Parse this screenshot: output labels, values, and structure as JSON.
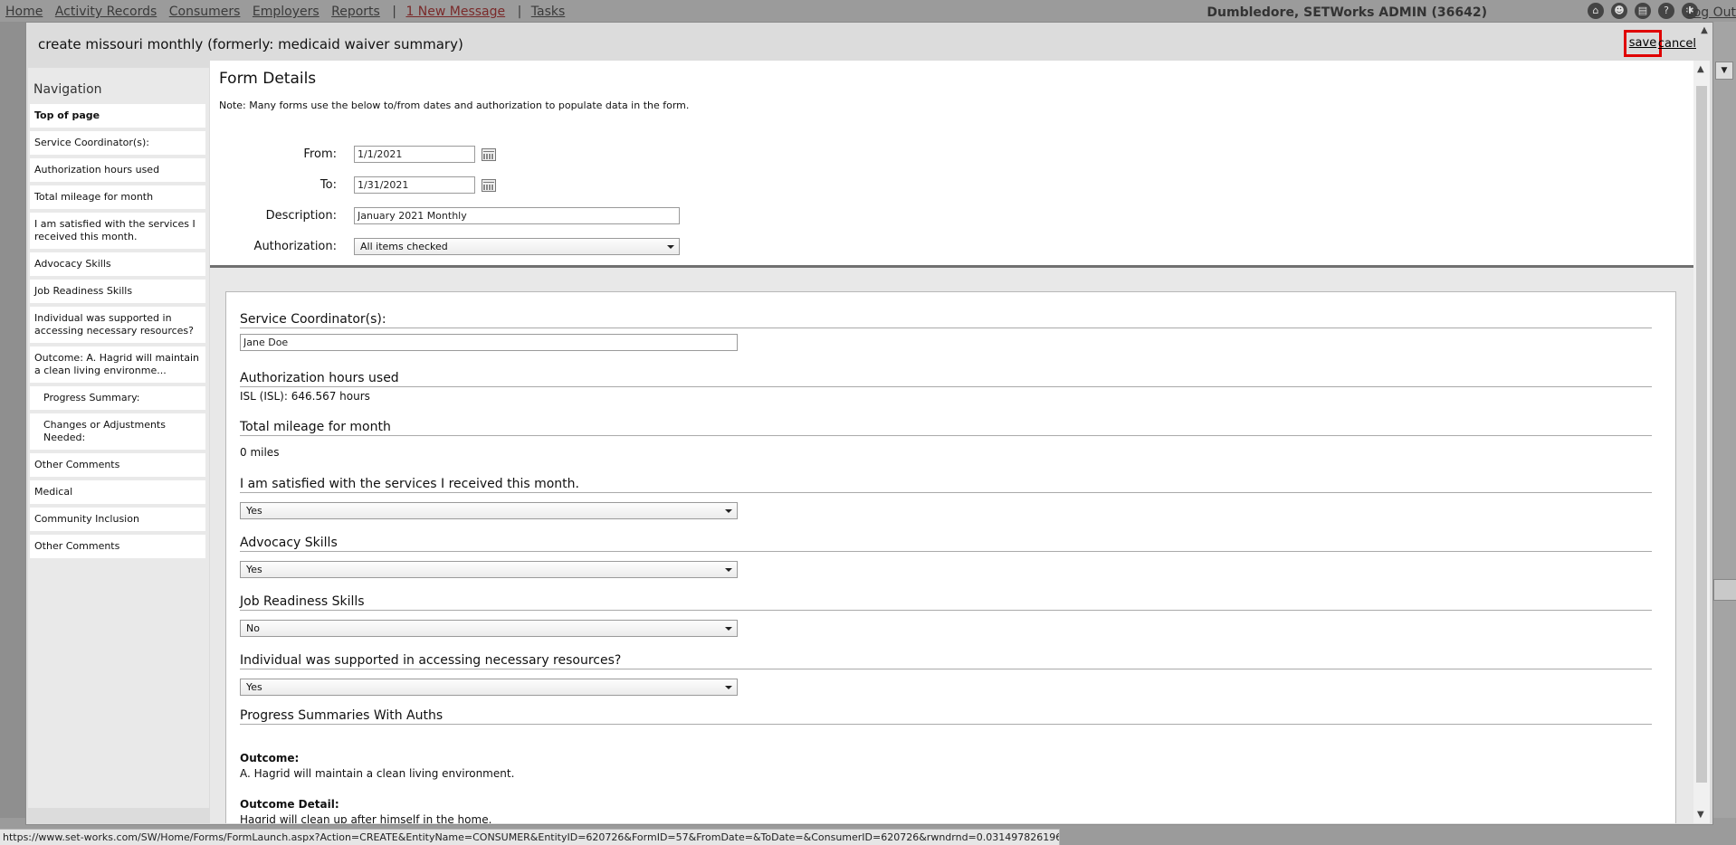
{
  "background": {
    "nav": [
      "Home",
      "Activity Records",
      "Consumers",
      "Employers",
      "Reports"
    ],
    "message": "1 New Message",
    "tasks": "Tasks",
    "user": "Dumbledore, SETWorks ADMIN (36642)",
    "logout": "Log Out"
  },
  "modal": {
    "title": "create missouri monthly (formerly: medicaid waiver summary)",
    "save_label": "save",
    "cancel_label": "cancel"
  },
  "sidebar": {
    "title": "Navigation",
    "items": [
      {
        "label": "Top of page"
      },
      {
        "label": "Service Coordinator(s):"
      },
      {
        "label": "Authorization hours used"
      },
      {
        "label": "Total mileage for month"
      },
      {
        "label": "I am satisfied with the services I received this month."
      },
      {
        "label": "Advocacy Skills"
      },
      {
        "label": "Job Readiness Skills"
      },
      {
        "label": "Individual was supported in accessing necessary resources?"
      },
      {
        "label": "Outcome: A. Hagrid will maintain a clean living environme..."
      },
      {
        "label": "Progress Summary:"
      },
      {
        "label": "Changes or Adjustments Needed:"
      },
      {
        "label": "Other Comments"
      },
      {
        "label": "Medical"
      },
      {
        "label": "Community Inclusion"
      },
      {
        "label": "Other Comments"
      }
    ]
  },
  "form_details": {
    "title": "Form Details",
    "note": "Note: Many forms use the below to/from dates and authorization to populate data in the form.",
    "from_label": "From:",
    "from_value": "1/1/2021",
    "to_label": "To:",
    "to_value": "1/31/2021",
    "description_label": "Description:",
    "description_value": "January 2021 Monthly",
    "authorization_label": "Authorization:",
    "authorization_value": "All items checked"
  },
  "sections": {
    "service_coordinator": {
      "heading": "Service Coordinator(s):",
      "value": "Jane Doe"
    },
    "auth_hours": {
      "heading": "Authorization hours used",
      "value": "ISL (ISL): 646.567 hours"
    },
    "mileage": {
      "heading": "Total mileage for month",
      "value": "0 miles"
    },
    "satisfied": {
      "heading": "I am satisfied with the services I received this month.",
      "value": "Yes"
    },
    "advocacy": {
      "heading": "Advocacy Skills",
      "value": "Yes"
    },
    "job_readiness": {
      "heading": "Job Readiness Skills",
      "value": "No"
    },
    "resources": {
      "heading": "Individual was supported in accessing necessary resources?",
      "value": "Yes"
    },
    "progress": {
      "heading": "Progress Summaries With Auths",
      "outcome_label": "Outcome:",
      "outcome_text": "A. Hagrid will maintain a clean living environment.",
      "detail_label": "Outcome Detail:",
      "detail_text": "Hagrid will clean up after himself in the home."
    }
  },
  "status_bar": {
    "url": "https://www.set-works.com/SW/Home/Forms/FormLaunch.aspx?Action=CREATE&EntityName=CONSUMER&EntityID=620726&FormID=57&FromDate=&ToDate=&ConsumerID=620726&rwndrnd=0.03149782619658248#"
  }
}
